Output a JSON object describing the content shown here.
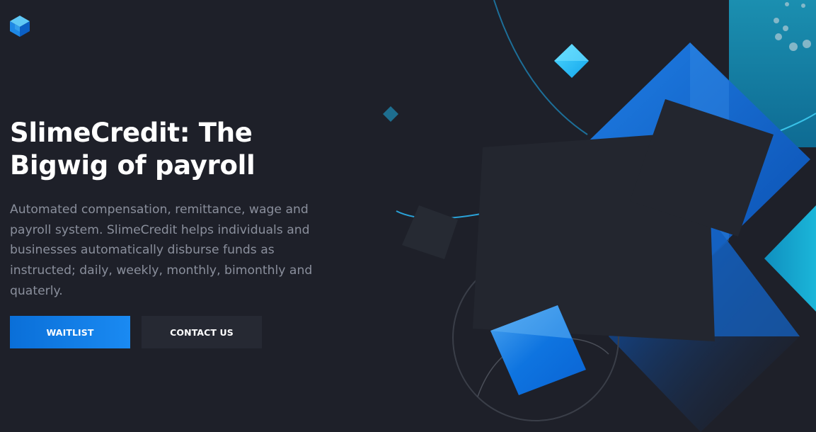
{
  "brand": {
    "logo_icon": "cube-logo-icon"
  },
  "hero": {
    "title": "SlimeCredit: The Bigwig of payroll",
    "description": "Automated compensation, remittance, wage and payroll system. SlimeCredit helps individuals and businesses automatically disburse funds as instructed; daily, weekly, monthly, bimonthly and quaterly."
  },
  "actions": {
    "waitlist_label": "WAITLIST",
    "contact_label": "CONTACT US"
  },
  "colors": {
    "background": "#1e2029",
    "accent": "#1083ee",
    "secondary_button": "#262933",
    "body_text": "#8a8f9c"
  }
}
